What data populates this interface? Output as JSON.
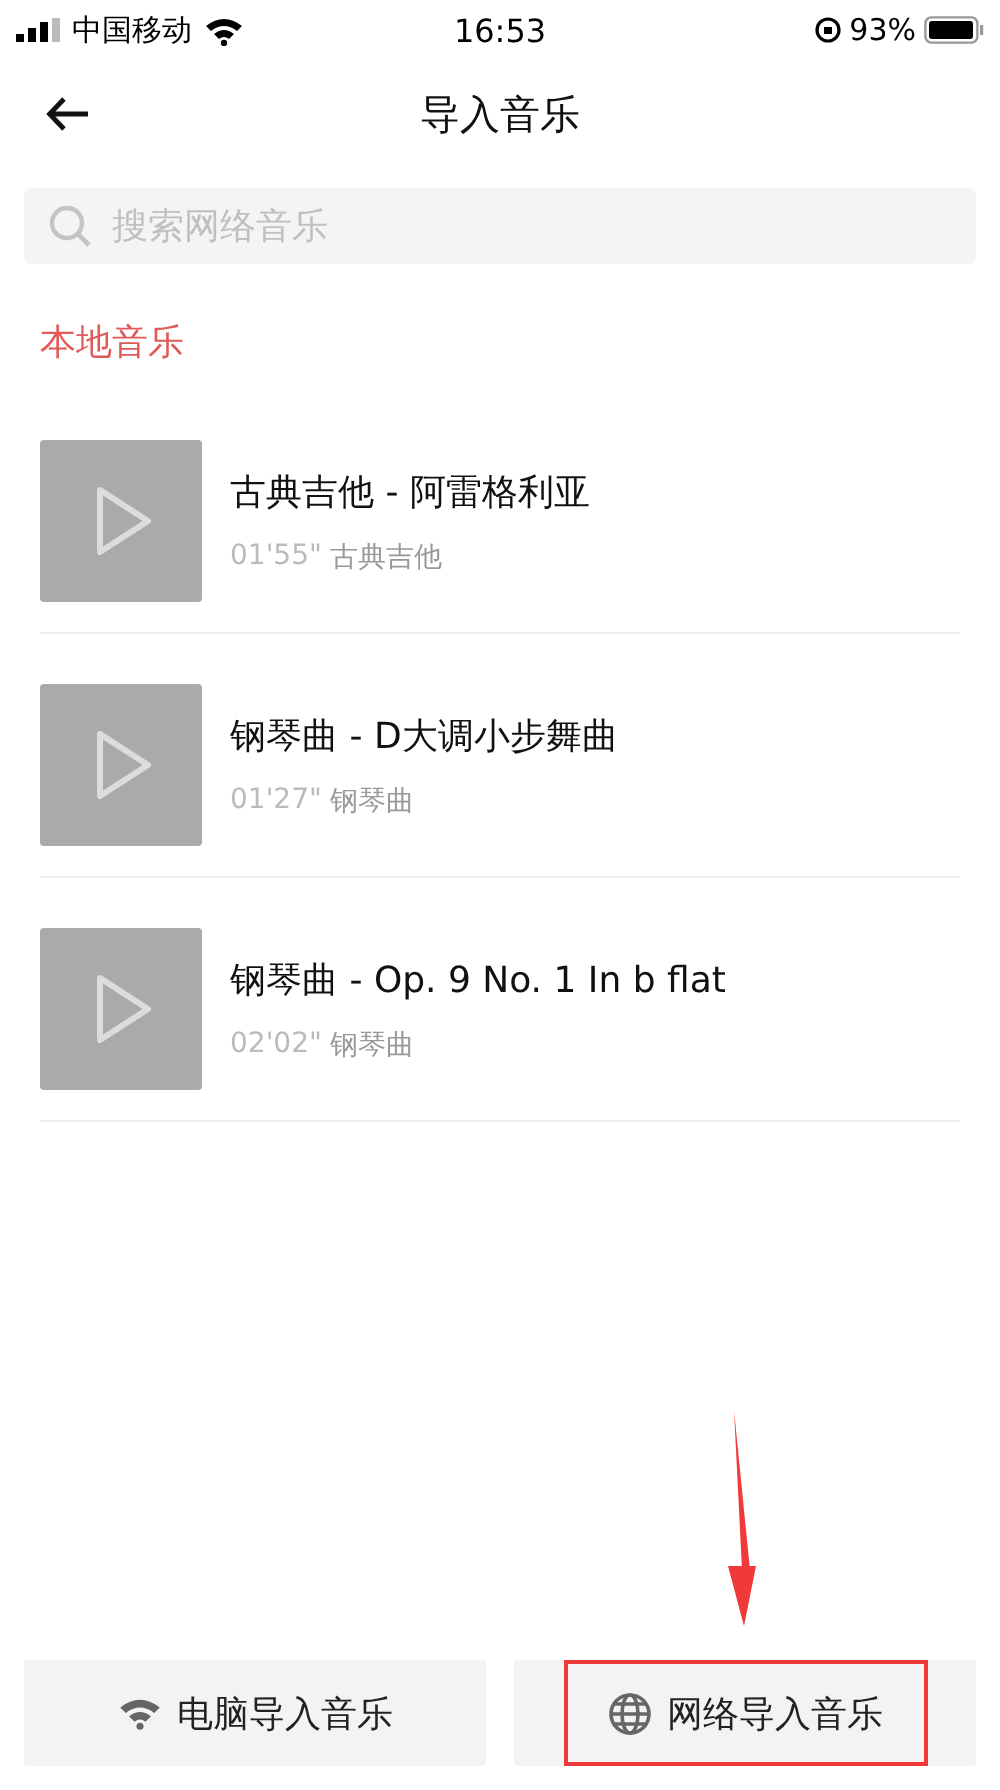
{
  "status_bar": {
    "carrier": "中国移动",
    "time": "16:53",
    "battery": "93%"
  },
  "header": {
    "title": "导入音乐"
  },
  "search": {
    "placeholder": "搜索网络音乐"
  },
  "section_title": "本地音乐",
  "songs": [
    {
      "title": "古典吉他 - 阿雷格利亚",
      "duration": "01'55\"",
      "album": "古典吉他"
    },
    {
      "title": "钢琴曲 - D大调小步舞曲",
      "duration": "01'27\"",
      "album": "钢琴曲"
    },
    {
      "title": "钢琴曲 - Op. 9 No. 1 In b flat",
      "duration": "02'02\"",
      "album": "钢琴曲"
    }
  ],
  "bottom_buttons": [
    {
      "kind": "wifi",
      "label": "电脑导入音乐",
      "highlighted": false
    },
    {
      "kind": "globe",
      "label": "网络导入音乐",
      "highlighted": true
    }
  ]
}
